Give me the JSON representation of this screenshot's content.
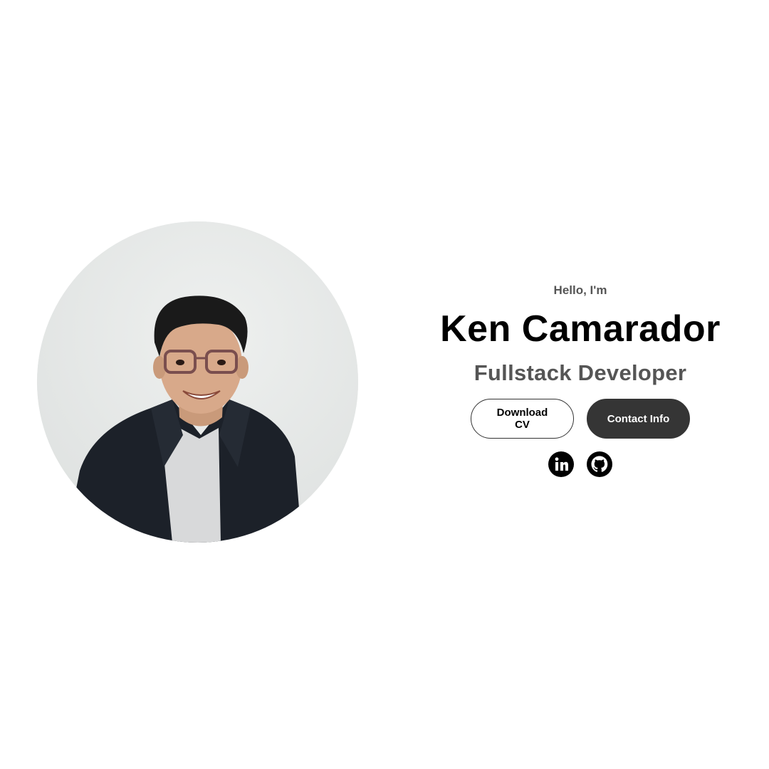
{
  "hero": {
    "greeting": "Hello, I'm",
    "name": "Ken Camarador",
    "role": "Fullstack Developer",
    "photo_alt": "Ken Camarador profile picture",
    "buttons": {
      "download_cv": "Download CV",
      "contact_info": "Contact Info"
    },
    "socials": [
      {
        "icon": "linkedin-icon",
        "label": "LinkedIn"
      },
      {
        "icon": "github-icon",
        "label": "GitHub"
      }
    ]
  },
  "colors": {
    "background": "#ffffff",
    "text_primary": "#000000",
    "text_secondary": "#555555",
    "button_dark": "#353535",
    "photo_backdrop": "#e9ebea"
  }
}
